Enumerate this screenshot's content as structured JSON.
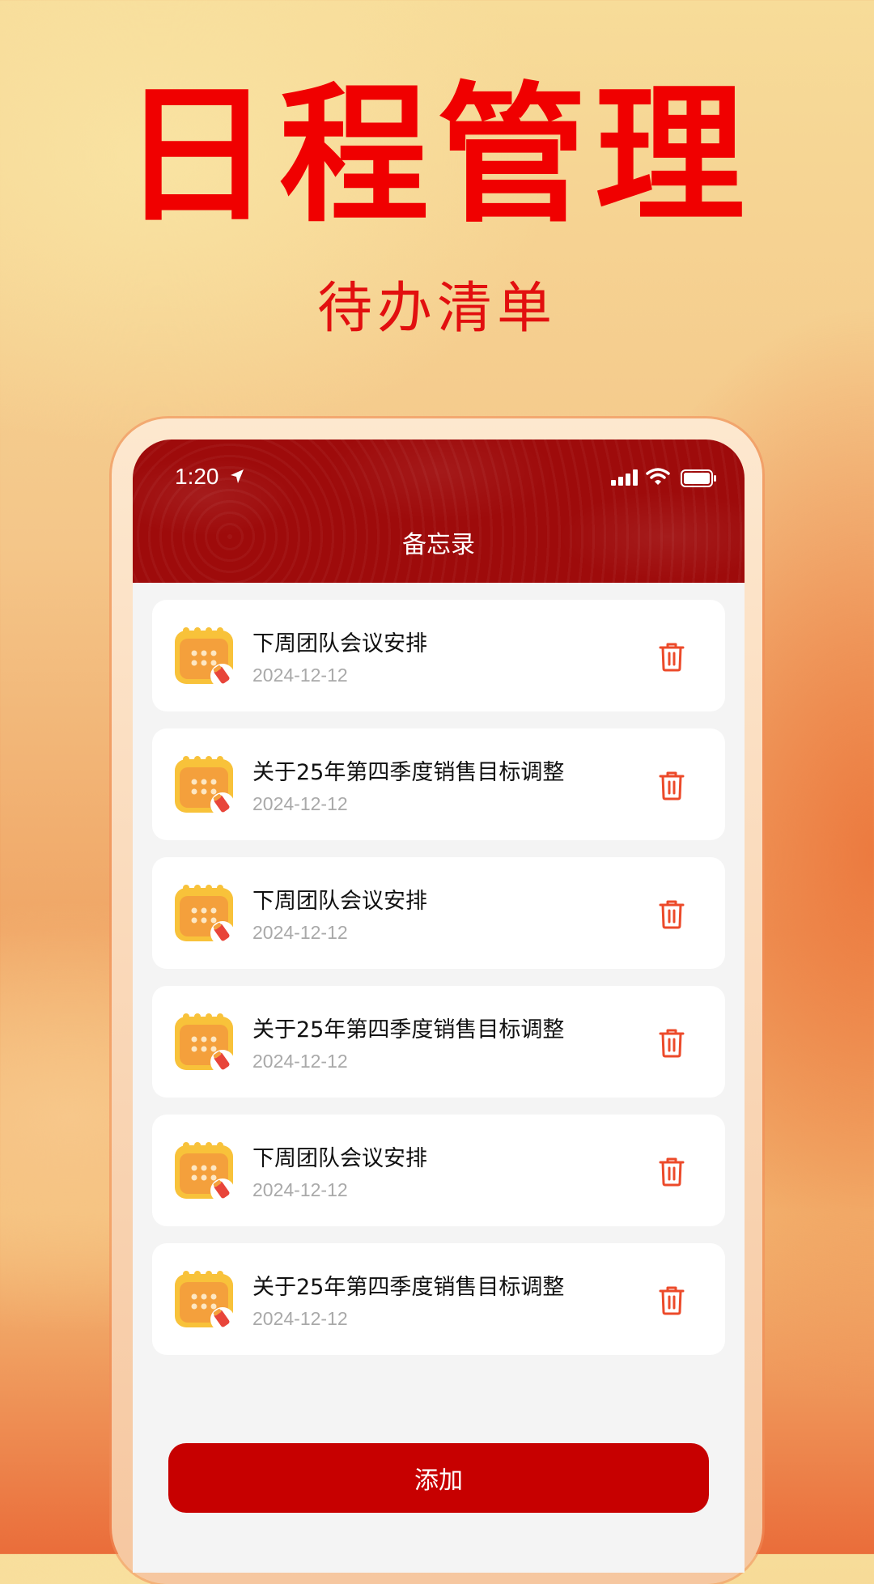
{
  "hero": {
    "title": "日程管理",
    "subtitle": "待办清单"
  },
  "status_bar": {
    "time": "1:20"
  },
  "header": {
    "title": "备忘录"
  },
  "memos": [
    {
      "title": "下周团队会议安排",
      "date": "2024-12-12"
    },
    {
      "title": "关于25年第四季度销售目标调整",
      "date": "2024-12-12"
    },
    {
      "title": "下周团队会议安排",
      "date": "2024-12-12"
    },
    {
      "title": "关于25年第四季度销售目标调整",
      "date": "2024-12-12"
    },
    {
      "title": "下周团队会议安排",
      "date": "2024-12-12"
    },
    {
      "title": "关于25年第四季度销售目标调整",
      "date": "2024-12-12"
    }
  ],
  "add_button": {
    "label": "添加"
  },
  "colors": {
    "accent": "#c70000",
    "header_bg": "#9e0b0b",
    "hero_title": "#f00000",
    "delete_icon": "#ec4a2a"
  },
  "icons": {
    "card_icon": "calendar-edit-icon",
    "delete": "trash-icon"
  }
}
